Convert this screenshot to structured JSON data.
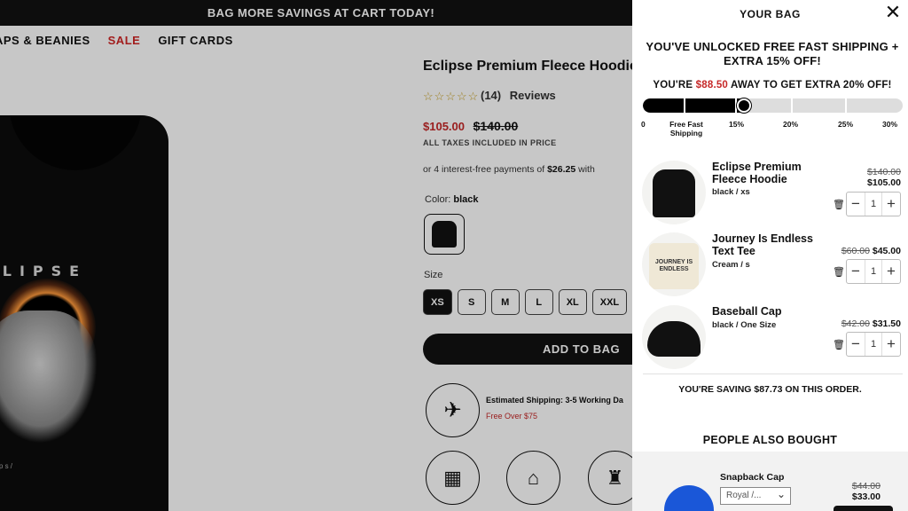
{
  "announcement": "BAG MORE SAVINGS AT CART TODAY!",
  "nav": {
    "caps": "APS & BEANIES",
    "sale": "SALE",
    "gift": "GIFT CARDS"
  },
  "product_image": {
    "brand_text": "CLIPSE",
    "caption": "a k l i p s /"
  },
  "product": {
    "title": "Eclipse Premium Fleece Hoodie",
    "stars": "☆☆☆☆☆",
    "review_count": "(14)",
    "reviews_label": "Reviews",
    "price": "$105.00",
    "compare_price": "$140.00",
    "taxes": "ALL TAXES INCLUDED IN PRICE",
    "installments_prefix": "or 4 interest-free payments of",
    "installment_amount": "$26.25",
    "installments_suffix": "with",
    "color_label": "Color:",
    "color_value": "black",
    "size_label": "Size",
    "sizes": [
      "XS",
      "S",
      "M",
      "L",
      "XL",
      "XXL"
    ],
    "add_to_bag": "ADD TO BAG",
    "shipping_estimate": "Estimated Shipping: 3-5 Working Da",
    "shipping_free": "Free Over $75"
  },
  "cart": {
    "title": "YOUR BAG",
    "unlocked": "YOU'VE UNLOCKED FREE FAST SHIPPING + EXTRA 15% OFF!",
    "away_prefix": "YOU'RE",
    "away_amount": "$88.50",
    "away_suffix": "AWAY TO GET EXTRA 20% OFF!",
    "progress": 0.38,
    "milestones": [
      {
        "label": "0"
      },
      {
        "label": "Free Fast Shipping"
      },
      {
        "label": "15%"
      },
      {
        "label": "20%"
      },
      {
        "label": "25%"
      },
      {
        "label": "30%"
      }
    ],
    "items": [
      {
        "name": "Eclipse Premium Fleece Hoodie",
        "variant": "black / xs",
        "old_price": "$140.00",
        "price": "$105.00",
        "qty": "1"
      },
      {
        "name": "Journey Is Endless Text Tee",
        "variant": "Cream / s",
        "old_price": "$60.00",
        "price": "$45.00",
        "qty": "1",
        "thumb_text": "JOURNEY IS ENDLESS"
      },
      {
        "name": "Baseball Cap",
        "variant": "black / One Size",
        "old_price": "$42.00",
        "price": "$31.50",
        "qty": "1"
      }
    ],
    "saving_prefix": "YOU'RE SAVING",
    "saving_amount": "$87.73",
    "saving_suffix": "ON THIS ORDER.",
    "people_also_bought": "PEOPLE ALSO BOUGHT",
    "recommendation": {
      "name": "Snapback Cap",
      "select_value": "Royal /...",
      "old_price": "$44.00",
      "price": "$33.00"
    }
  },
  "colors": {
    "accent_red": "#c62828",
    "dark": "#111111",
    "progress_track": "#dddddd"
  }
}
